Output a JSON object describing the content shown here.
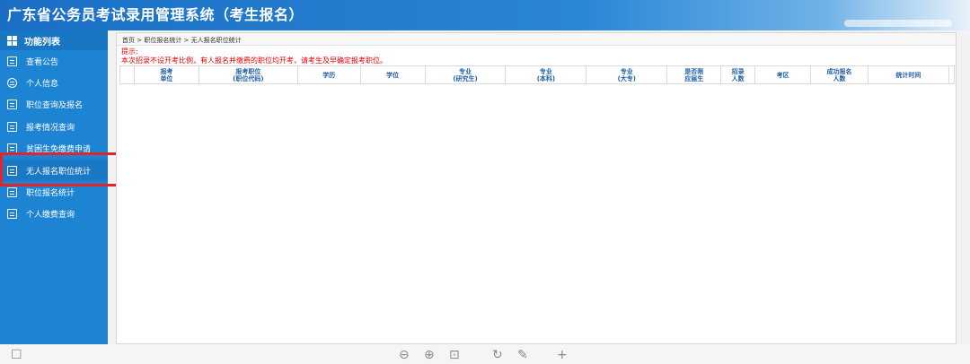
{
  "header": {
    "title": "广东省公务员考试录用管理系统（考生报名）"
  },
  "sidebar": {
    "heading": "功能列表",
    "items": [
      {
        "label": "查看公告"
      },
      {
        "label": "个人信息"
      },
      {
        "label": "职位查询及报名"
      },
      {
        "label": "报考情况查询"
      },
      {
        "label": "贫困生免缴费申请"
      },
      {
        "label": "无人报名职位统计"
      },
      {
        "label": "职位报名统计"
      },
      {
        "label": "个人缴费查询"
      }
    ]
  },
  "breadcrumb": "首页 > 职位报名统计 > 无人报名职位统计",
  "tip": {
    "title": "提示:",
    "text": "本次招录不设开考比例，有人报名并缴费的职位均开考，请考生及早确定报考职位。"
  },
  "table": {
    "headers": [
      {
        "l1": "",
        "l2": ""
      },
      {
        "l1": "报考",
        "l2": "单位"
      },
      {
        "l1": "报考职位",
        "l2": "(职位代码)"
      },
      {
        "l1": "学历",
        "l2": ""
      },
      {
        "l1": "学位",
        "l2": ""
      },
      {
        "l1": "专业",
        "l2": "(研究生)"
      },
      {
        "l1": "专业",
        "l2": "(本科)"
      },
      {
        "l1": "专业",
        "l2": "(大专)"
      },
      {
        "l1": "是否限",
        "l2": "应届生"
      },
      {
        "l1": "招录",
        "l2": "人数"
      },
      {
        "l1": "考区",
        "l2": ""
      },
      {
        "l1": "成功报名",
        "l2": "人数"
      },
      {
        "l1": "统计时间",
        "l2": ""
      },
      {
        "l1": "",
        "l2": ""
      }
    ]
  }
}
